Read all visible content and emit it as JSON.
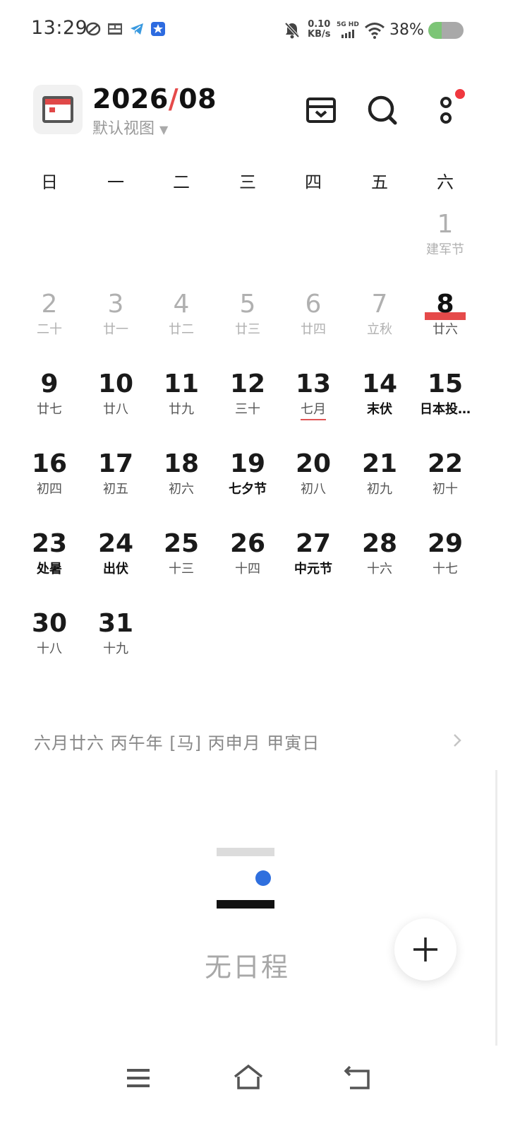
{
  "status_bar": {
    "time": "13:29",
    "net_speed_value": "0.10",
    "net_speed_unit": "KB/s",
    "network": "5G HD",
    "battery_percent": "38%",
    "battery_level": 0.38,
    "icons": [
      "app-icon",
      "toutiao-icon",
      "telegram-icon",
      "app-store-icon",
      "mute-bell-icon",
      "signal-icon",
      "wifi-icon",
      "battery-icon"
    ]
  },
  "header": {
    "year": "2026",
    "slash": "/",
    "month": "08",
    "view_label": "默认视图",
    "view_arrow": "▼"
  },
  "weekdays": [
    "日",
    "一",
    "二",
    "三",
    "四",
    "五",
    "六"
  ],
  "days": [
    {
      "num": "1",
      "lunar": "建军节"
    },
    {
      "num": "2",
      "lunar": "二十"
    },
    {
      "num": "3",
      "lunar": "廿一"
    },
    {
      "num": "4",
      "lunar": "廿二"
    },
    {
      "num": "5",
      "lunar": "廿三"
    },
    {
      "num": "6",
      "lunar": "廿四"
    },
    {
      "num": "7",
      "lunar": "立秋"
    },
    {
      "num": "8",
      "lunar": "廿六"
    },
    {
      "num": "9",
      "lunar": "廿七"
    },
    {
      "num": "10",
      "lunar": "廿八"
    },
    {
      "num": "11",
      "lunar": "廿九"
    },
    {
      "num": "12",
      "lunar": "三十"
    },
    {
      "num": "13",
      "lunar": "七月"
    },
    {
      "num": "14",
      "lunar": "末伏"
    },
    {
      "num": "15",
      "lunar": "日本投…"
    },
    {
      "num": "16",
      "lunar": "初四"
    },
    {
      "num": "17",
      "lunar": "初五"
    },
    {
      "num": "18",
      "lunar": "初六"
    },
    {
      "num": "19",
      "lunar": "七夕节"
    },
    {
      "num": "20",
      "lunar": "初八"
    },
    {
      "num": "21",
      "lunar": "初九"
    },
    {
      "num": "22",
      "lunar": "初十"
    },
    {
      "num": "23",
      "lunar": "处暑"
    },
    {
      "num": "24",
      "lunar": "出伏"
    },
    {
      "num": "25",
      "lunar": "十三"
    },
    {
      "num": "26",
      "lunar": "十四"
    },
    {
      "num": "27",
      "lunar": "中元节"
    },
    {
      "num": "28",
      "lunar": "十六"
    },
    {
      "num": "29",
      "lunar": "十七"
    },
    {
      "num": "30",
      "lunar": "十八"
    },
    {
      "num": "31",
      "lunar": "十九"
    }
  ],
  "lunar_info": "六月廿六  丙午年 [马] 丙申月 甲寅日",
  "empty_state": "无日程",
  "colors": {
    "accent_red": "#e54a4a",
    "empty_dot_blue": "#2f6fde",
    "battery_green": "#7cc576"
  },
  "nav": [
    "menu-icon",
    "home-icon",
    "back-icon"
  ]
}
